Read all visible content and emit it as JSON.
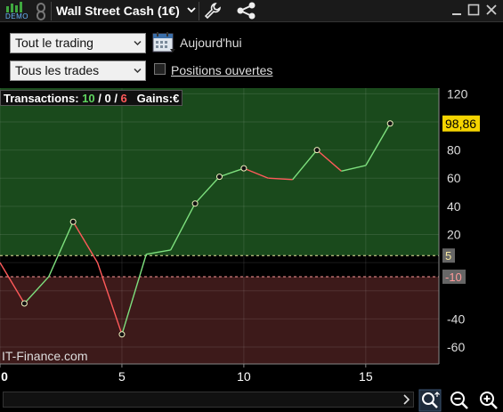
{
  "titlebar": {
    "demo_label": "DEMO",
    "title": "Wall Street Cash (1€)"
  },
  "toolbar": {
    "period_select": "Tout le trading",
    "trades_select": "Tous les trades",
    "today_label": "Aujourd'hui",
    "open_positions_label": "Positions ouvertes"
  },
  "info": {
    "transactions_label": "Transactions:",
    "wins": "10",
    "sep1": " / ",
    "neutral": "0",
    "sep2": " / ",
    "losses": "6",
    "gains_label": "Gains:",
    "gains_value": "€"
  },
  "watermark": "IT-Finance.com",
  "colors": {
    "positive_zone": "#1a4a1c",
    "negative_zone": "#3d1a1a",
    "win_line": "#7ee07e",
    "loss_line": "#ff5a5a",
    "last_value_bg": "#f5d400",
    "threshold_bg": "#666666"
  },
  "chart_data": {
    "type": "line",
    "x": [
      0,
      1,
      2,
      3,
      4,
      5,
      6,
      7,
      8,
      9,
      10,
      11,
      12,
      13,
      14,
      15,
      16
    ],
    "y": [
      0,
      -29,
      -10,
      29,
      0,
      -51,
      6,
      9,
      42,
      61,
      67,
      60,
      59,
      80,
      65,
      69,
      98.86
    ],
    "markers_at": [
      1,
      3,
      5,
      8,
      9,
      10,
      13,
      16
    ],
    "xlim": [
      0,
      18
    ],
    "ylim": [
      -72,
      124
    ],
    "xticks": [
      0,
      5,
      10,
      15
    ],
    "yticks": [
      120,
      100,
      80,
      60,
      40,
      20,
      0,
      -20,
      -40,
      -60
    ],
    "ytick_labels": [
      "120",
      "100",
      "80",
      "60",
      "40",
      "20",
      "",
      "",
      "-40",
      "-60"
    ],
    "last_value_label": "98,86",
    "upper_threshold": 5,
    "upper_threshold_label": "5",
    "lower_threshold": -10,
    "lower_threshold_label": "-10",
    "grid": true
  }
}
